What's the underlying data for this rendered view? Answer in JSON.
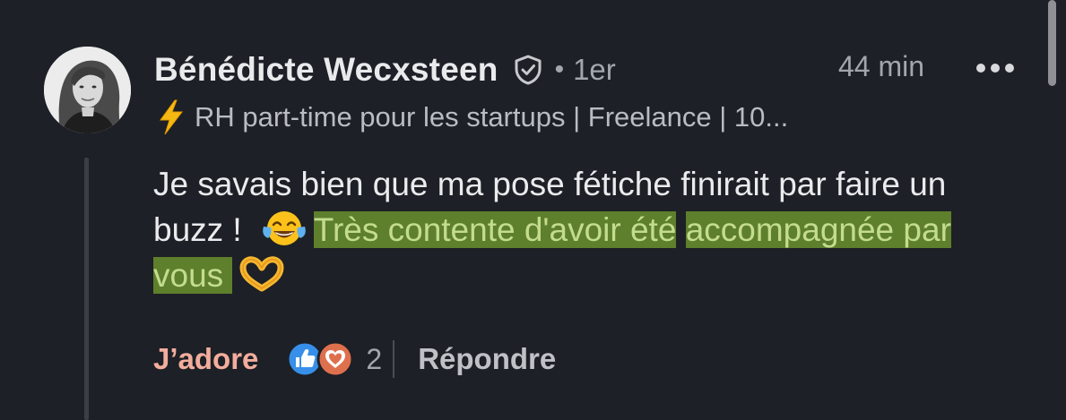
{
  "comment": {
    "author_name": "Bénédicte Wecxsteen",
    "separator_dot": "•",
    "connection_degree": "1er",
    "time_ago": "44 min",
    "headline": "RH part-time pour les startups | Freelance | 10...",
    "body_line1": "Je savais bien que ma pose fétiche finirait par faire un buzz !",
    "body_highlight_part1": "Très contente d'avoir été",
    "body_highlight_part2": "accompagnée par vous ",
    "actions": {
      "love_label": "J’adore",
      "reaction_count": "2",
      "reply_label": "Répondre"
    }
  },
  "icons": {
    "verified": "verified-shield-icon",
    "more": "more-options-icon",
    "bolt": "high-voltage-emoji",
    "laugh": "tears-of-joy-emoji",
    "heart_hands": "heart-hands-emoji",
    "like_reaction": "like-reaction-icon",
    "love_reaction": "love-reaction-icon"
  },
  "colors": {
    "background": "#1d2026",
    "author_text": "#e9eaec",
    "secondary_text": "#a3a6ac",
    "highlight_bg": "#5e7f2c",
    "highlight_text": "#c3dc8f",
    "love_action": "#f3ad9d",
    "like_blue": "#378fe9",
    "love_orange": "#df704d"
  }
}
